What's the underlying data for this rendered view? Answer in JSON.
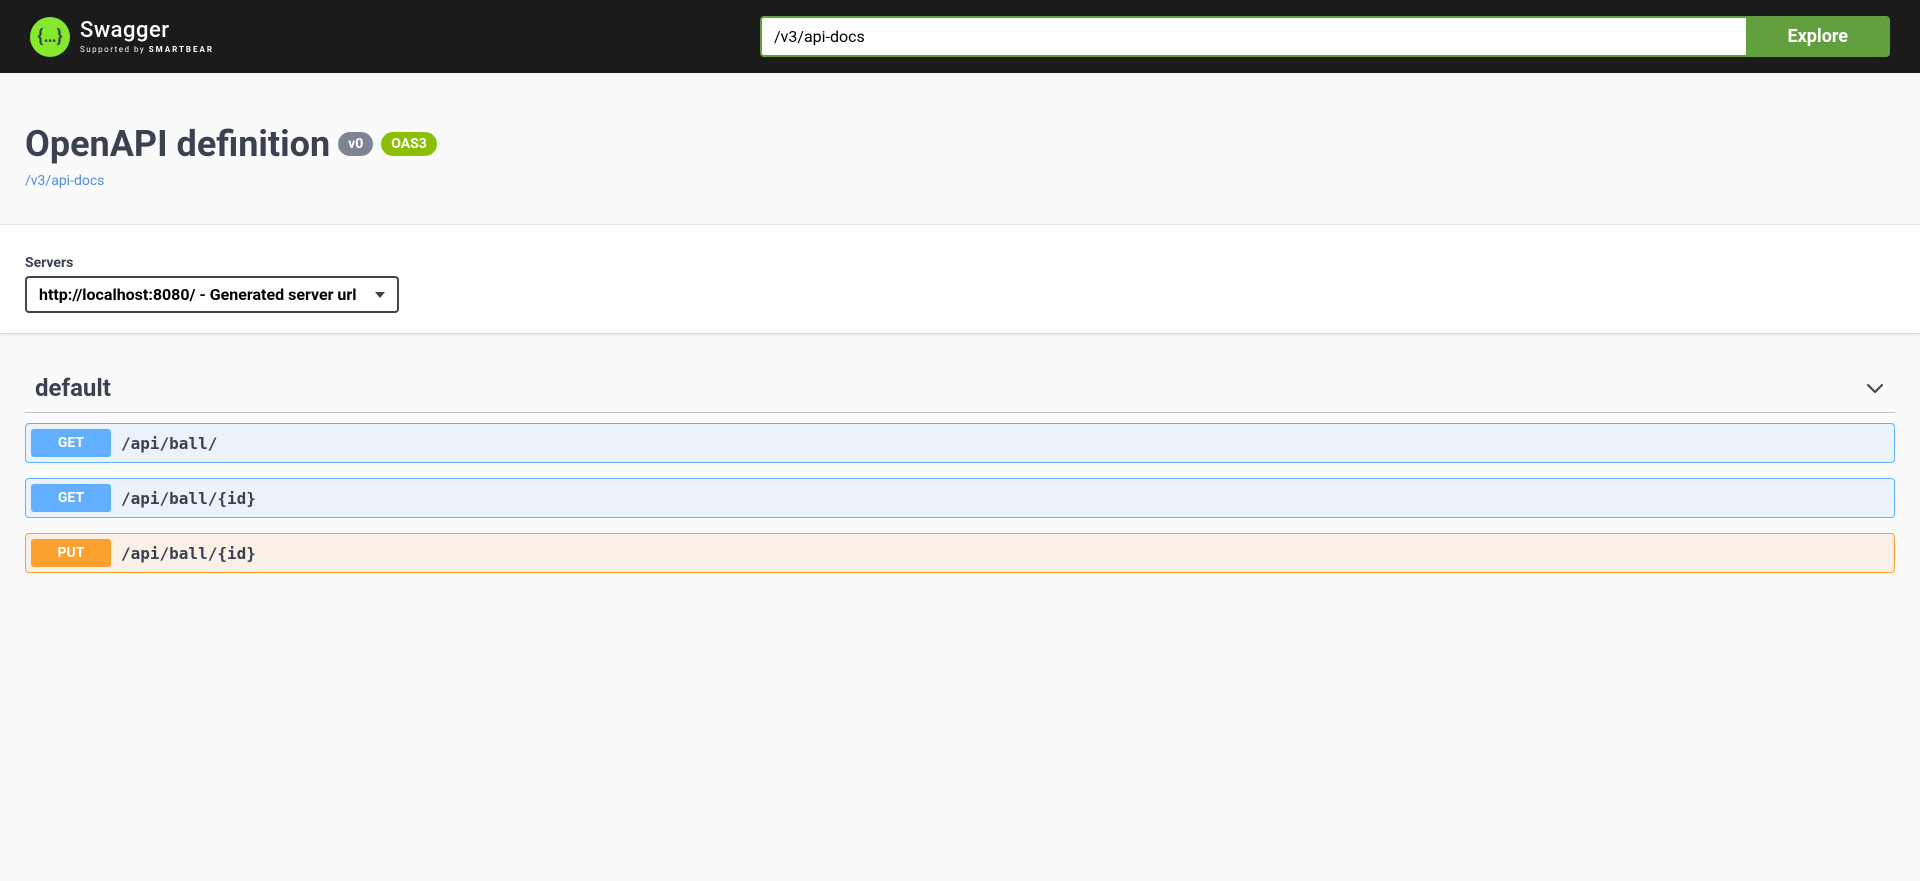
{
  "topbar": {
    "logo_text": "Swagger",
    "logo_sub_prefix": "Supported by ",
    "logo_sub_brand": "SMARTBEAR",
    "url_value": "/v3/api-docs",
    "explore_label": "Explore"
  },
  "info": {
    "title": "OpenAPI definition",
    "version": "v0",
    "oas_badge": "OAS3",
    "spec_link": "/v3/api-docs"
  },
  "servers": {
    "label": "Servers",
    "selected": "http://localhost:8080/ - Generated server url"
  },
  "tag": {
    "name": "default"
  },
  "operations": [
    {
      "method": "GET",
      "method_class": "get",
      "path": "/api/ball/"
    },
    {
      "method": "GET",
      "method_class": "get",
      "path": "/api/ball/{id}"
    },
    {
      "method": "PUT",
      "method_class": "put",
      "path": "/api/ball/{id}"
    }
  ]
}
